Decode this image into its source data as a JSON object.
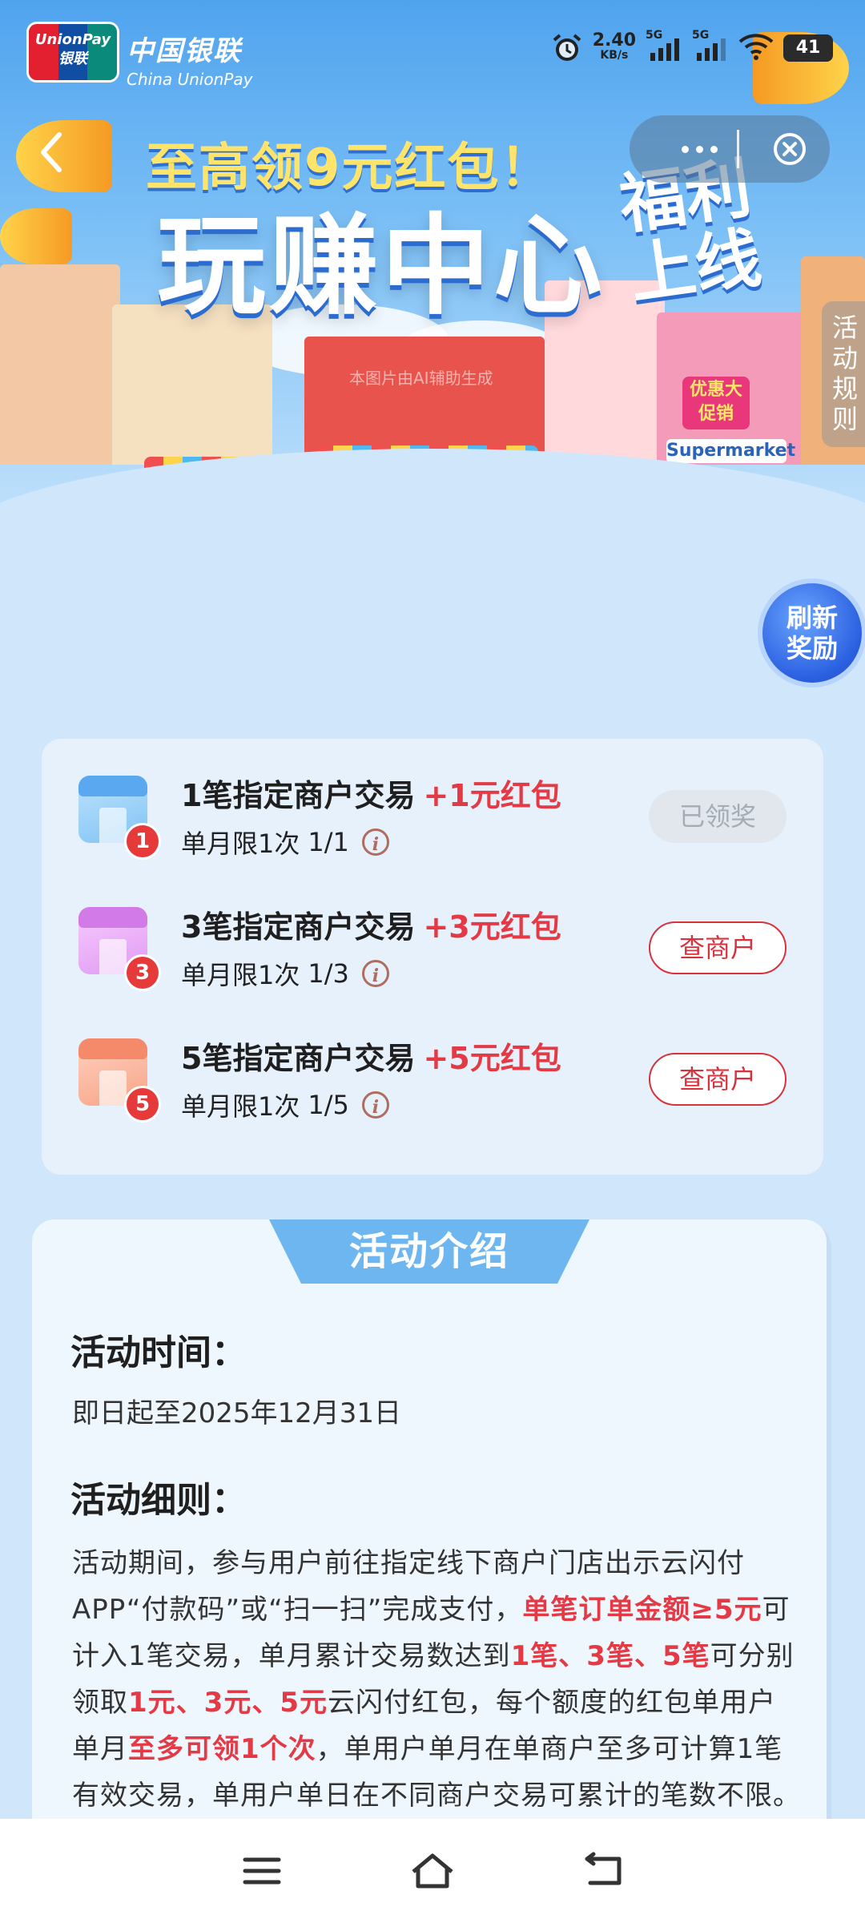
{
  "status_bar": {
    "network_speed_value": "2.40",
    "network_speed_unit": "KB/s",
    "signal1_label": "5G",
    "signal2_label": "5G",
    "battery": "41"
  },
  "brand": {
    "logo_text_top": "UnionPay",
    "logo_text_bottom": "银联",
    "name_cn": "中国银联",
    "name_en": "China UnionPay"
  },
  "banner": {
    "headline_top": "至高领9元红包！",
    "headline_main": "玩赚中心",
    "headline_side": "福利上线",
    "ai_note": "本图片由AI辅助生成",
    "sign_sale": "优惠大促销",
    "sign_supermarket": "Supermarket"
  },
  "side": {
    "rules_label": "活动规则",
    "refresh_label_line1": "刷新",
    "refresh_label_line2": "奖励"
  },
  "tasks": [
    {
      "num": "1",
      "title": "1笔指定商户交易",
      "bonus": "+1元红包",
      "limit": "单月限1次",
      "progress": "1/1",
      "button": "已领奖",
      "state": "done",
      "color": "#5aa8ef"
    },
    {
      "num": "3",
      "title": "3笔指定商户交易",
      "bonus": "+3元红包",
      "limit": "单月限1次",
      "progress": "1/3",
      "button": "查商户",
      "state": "go",
      "color": "#d27be8"
    },
    {
      "num": "5",
      "title": "5笔指定商户交易",
      "bonus": "+5元红包",
      "limit": "单月限1次",
      "progress": "1/5",
      "button": "查商户",
      "state": "go",
      "color": "#f58a6a"
    }
  ],
  "intro": {
    "tab_title": "活动介绍",
    "time_heading": "活动时间：",
    "time_text": "即日起至2025年12月31日",
    "rules_heading": "活动细则：",
    "body": [
      {
        "t": "活动期间，参与用户前往指定线下商户门店出示云闪付APP“付款码”或“扫一扫”完成支付，",
        "hl": false
      },
      {
        "t": "单笔订单金额≥5元",
        "hl": true
      },
      {
        "t": "可计入1笔交易，单月累计交易数达到",
        "hl": false
      },
      {
        "t": "1笔、3笔、5笔",
        "hl": true
      },
      {
        "t": "可分别领取",
        "hl": false
      },
      {
        "t": "1元、3元、5元",
        "hl": true
      },
      {
        "t": "云闪付红包，每个额度的红包单用户单月",
        "hl": false
      },
      {
        "t": "至多可领1个次",
        "hl": true
      },
      {
        "t": "，单用户单月在单商户至多可计算1笔有效交易，单用户单日在不同商户交易可累计的笔数不限。",
        "hl": false
      }
    ]
  },
  "colors": {
    "accent_red": "#e43a45",
    "primary_blue": "#6eb6ef",
    "page_bg": "#cfe6fb"
  },
  "icons": {
    "back": "chevron-left-icon",
    "more": "more-dots-icon",
    "close": "close-circle-icon",
    "info": "info-icon",
    "menu": "menu-icon",
    "home": "home-icon",
    "return": "back-arrow-icon",
    "alarm": "alarm-icon",
    "wifi": "wifi-icon"
  }
}
